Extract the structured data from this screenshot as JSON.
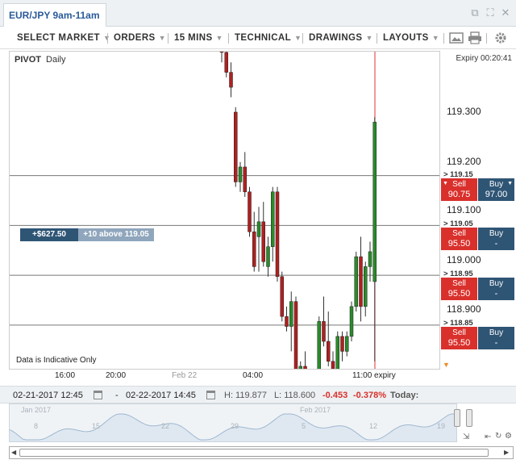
{
  "tab": {
    "title": "EUR/JPY 9am-11am"
  },
  "toolbar": {
    "menus": [
      "SELECT MARKET",
      "ORDERS",
      "15 MINS",
      "TECHNICAL",
      "DRAWINGS",
      "LAYOUTS"
    ]
  },
  "chart": {
    "indicator": "PIVOT",
    "indicator_period": "Daily",
    "disclaimer": "Data is Indicative Only",
    "expiry": "Expiry 00:20:41",
    "x_ticks": [
      "16:00",
      "20:00",
      "Feb 22",
      "04:00",
      "11:00 expiry"
    ],
    "y_ticks": [
      "119.300",
      "119.200",
      "119.100",
      "119.000",
      "118.900"
    ],
    "position": {
      "pnl": "+$627.50",
      "desc": "+10 above 119.05"
    }
  },
  "strikes": [
    {
      "level": "> 119.15",
      "sell_label": "Sell",
      "sell_value": "90.75",
      "buy_label": "Buy",
      "buy_value": "97.00"
    },
    {
      "level": "> 119.05",
      "sell_label": "Sell",
      "sell_value": "95.50",
      "buy_label": "Buy",
      "buy_value": "-"
    },
    {
      "level": "> 118.95",
      "sell_label": "Sell",
      "sell_value": "95.50",
      "buy_label": "Buy",
      "buy_value": "-"
    },
    {
      "level": "> 118.85",
      "sell_label": "Sell",
      "sell_value": "95.50",
      "buy_label": "Buy",
      "buy_value": "-"
    }
  ],
  "status": {
    "from": "02-21-2017 12:45",
    "dash": "-",
    "to": "02-22-2017 14:45",
    "high": "H: 119.877",
    "low": "L: 118.600",
    "change": "-0.453",
    "change_pct": "-0.378%",
    "today": "Today:"
  },
  "navigator": {
    "labels": [
      "Jan 2017",
      "8",
      "15",
      "22",
      "29",
      "Feb 2017",
      "5",
      "12",
      "19"
    ]
  },
  "colors": {
    "sell": "#d9302c",
    "buy": "#2f5575",
    "up": "#2a8a2a",
    "down": "#b02020",
    "expiry_line": "#e03030"
  },
  "chart_data": {
    "type": "candlestick",
    "ylim": [
      118.8,
      119.4
    ],
    "candles": [
      [
        119.43,
        119.44,
        119.4,
        119.42
      ],
      [
        119.42,
        119.43,
        119.37,
        119.38
      ],
      [
        119.38,
        119.4,
        119.33,
        119.35
      ],
      [
        119.3,
        119.31,
        119.15,
        119.16
      ],
      [
        119.16,
        119.2,
        119.14,
        119.19
      ],
      [
        119.19,
        119.22,
        119.13,
        119.14
      ],
      [
        119.14,
        119.15,
        119.05,
        119.06
      ],
      [
        119.06,
        119.1,
        118.98,
        118.99
      ],
      [
        119.05,
        119.11,
        118.98,
        119.08
      ],
      [
        119.08,
        119.12,
        118.99,
        119.0
      ],
      [
        118.99,
        119.05,
        118.97,
        119.03
      ],
      [
        119.03,
        119.15,
        119.0,
        119.14
      ],
      [
        119.14,
        119.15,
        118.96,
        118.97
      ],
      [
        118.97,
        118.98,
        118.88,
        118.89
      ],
      [
        118.89,
        118.91,
        118.86,
        118.87
      ],
      [
        118.87,
        118.94,
        118.82,
        118.92
      ],
      [
        118.92,
        118.93,
        118.76,
        118.77
      ],
      [
        118.77,
        118.8,
        118.73,
        118.79
      ],
      [
        118.79,
        118.82,
        118.7,
        118.72
      ],
      [
        118.72,
        118.76,
        118.71,
        118.75
      ],
      [
        118.75,
        118.77,
        118.72,
        118.74
      ],
      [
        118.74,
        118.89,
        118.73,
        118.88
      ],
      [
        118.88,
        118.93,
        118.83,
        118.84
      ],
      [
        118.84,
        118.9,
        118.79,
        118.8
      ],
      [
        118.8,
        118.82,
        118.76,
        118.78
      ],
      [
        118.78,
        118.86,
        118.77,
        118.85
      ],
      [
        118.85,
        118.86,
        118.8,
        118.82
      ],
      [
        118.82,
        118.86,
        118.81,
        118.85
      ],
      [
        118.85,
        118.92,
        118.84,
        118.91
      ],
      [
        118.91,
        119.02,
        118.9,
        119.01
      ],
      [
        119.01,
        119.05,
        118.88,
        118.91
      ],
      [
        118.91,
        119.0,
        118.89,
        118.99
      ],
      [
        118.99,
        119.04,
        118.96,
        119.02
      ],
      [
        118.96,
        119.29,
        118.8,
        119.28
      ]
    ]
  }
}
